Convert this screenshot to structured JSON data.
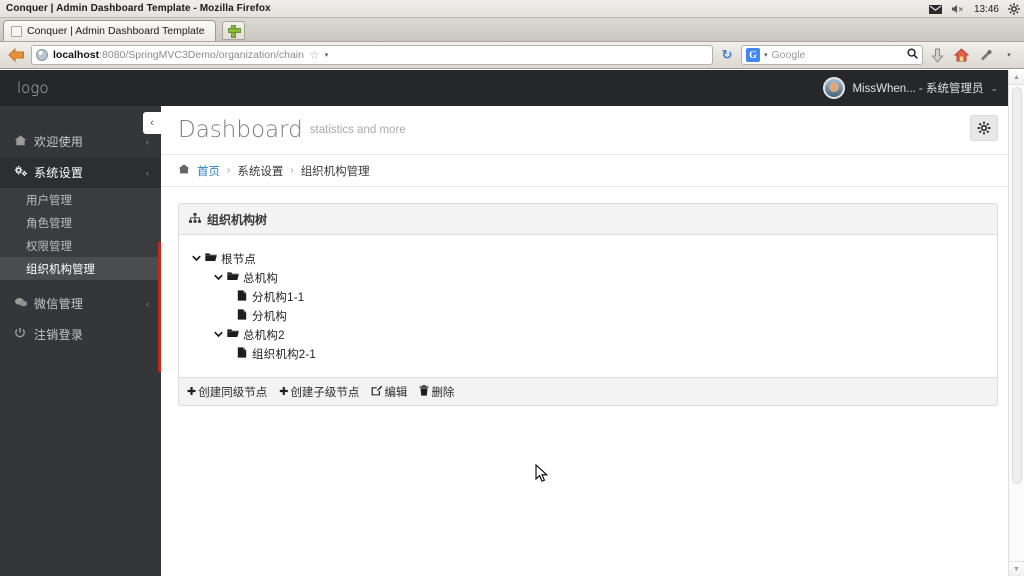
{
  "browser": {
    "window_title": "Conquer | Admin Dashboard Template - Mozilla Firefox",
    "tab_title": "Conquer | Admin Dashboard Template",
    "newtab_label": "+",
    "url_host": "localhost",
    "url_path": ":8080/SpringMVC3Demo/organization/chain",
    "search_engine": "Google",
    "search_g": "G",
    "back_icon": "back-arrow-icon",
    "reload_icon": "↻",
    "star_icon": "☆",
    "caret": "▾",
    "magnifier_icon": "🔍",
    "download_icon": "⇩",
    "home_icon": "⌂",
    "bookmarks_icon": "🔖",
    "menu_icon": "▾",
    "tray": {
      "mail_icon": "✉",
      "volume_icon": "🔇",
      "clock": "13:46",
      "settings_icon": "⚙"
    }
  },
  "app": {
    "logo": "logo",
    "user": {
      "name": "MissWhen... - 系统管理员",
      "caret": "⌄"
    },
    "collapse_toggle": "‹"
  },
  "sidebar": {
    "items": [
      {
        "label": "欢迎使用",
        "icon": "⌂",
        "arrow": "‹",
        "active": false
      },
      {
        "label": "系统设置",
        "icon": "⚙",
        "arrow": "‹",
        "active": true
      }
    ],
    "submenu": [
      {
        "label": "用户管理",
        "active": false
      },
      {
        "label": "角色管理",
        "active": false
      },
      {
        "label": "权限管理",
        "active": false
      },
      {
        "label": "组织机构管理",
        "active": true
      }
    ],
    "items_after": [
      {
        "label": "微信管理",
        "icon": "💬",
        "arrow": "‹",
        "active": false
      },
      {
        "label": "注销登录",
        "icon": "⏻",
        "arrow": "",
        "active": false
      }
    ],
    "accent_color": "#c2281e"
  },
  "page": {
    "title": "Dashboard",
    "subtitle": "statistics and more",
    "gear_icon": "⚙"
  },
  "breadcrumb": {
    "home_icon": "⌂",
    "items": [
      {
        "label": "首页",
        "link": true
      },
      {
        "label": "系统设置",
        "link": false
      },
      {
        "label": "组织机构管理",
        "link": false
      }
    ],
    "separator": "›"
  },
  "panel": {
    "title": "组织机构树",
    "title_icon": "sitemap-icon",
    "tree": [
      {
        "label": "根节点",
        "level": 0,
        "type": "folder",
        "expanded": true
      },
      {
        "label": "总机构",
        "level": 1,
        "type": "folder",
        "expanded": true
      },
      {
        "label": "分机构1-1",
        "level": 2,
        "type": "file",
        "expanded": false
      },
      {
        "label": "分机构",
        "level": 2,
        "type": "file",
        "expanded": false
      },
      {
        "label": "总机构2",
        "level": 1,
        "type": "folder",
        "expanded": true
      },
      {
        "label": "组织机构2-1",
        "level": 2,
        "type": "file",
        "expanded": false
      }
    ],
    "tree_icons": {
      "chevron_expanded": "⌄",
      "folder": "📂",
      "file": "📄"
    },
    "actions": [
      {
        "label": "创建同级节点",
        "icon": "✚"
      },
      {
        "label": "创建子级节点",
        "icon": "✚"
      },
      {
        "label": "编辑",
        "icon": "✎"
      },
      {
        "label": "删除",
        "icon": "🗑"
      }
    ]
  },
  "scrollbar": {
    "up_arrow": "▲",
    "down_arrow": "▼"
  }
}
